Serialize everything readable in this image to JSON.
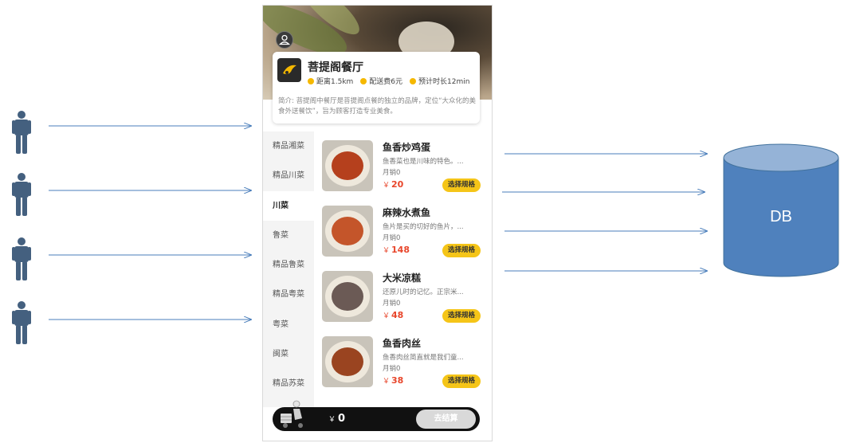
{
  "colors": {
    "arrow": "#4a7ebb",
    "person": "#44607f",
    "db_body": "#4f81bd",
    "db_top": "#95b3d7",
    "accent_yellow": "#f5c518",
    "price_red": "#e8462b"
  },
  "diagram": {
    "users": [
      {
        "icon": "person-icon"
      },
      {
        "icon": "person-icon"
      },
      {
        "icon": "person-icon"
      },
      {
        "icon": "person-icon"
      }
    ],
    "db_label": "DB"
  },
  "app": {
    "shop_name": "菩提阁餐厅",
    "meta": {
      "distance": "距离1.5km",
      "delivery_fee": "配送费6元",
      "eta": "预计时长12min"
    },
    "description": "简介: 菩提阁中餐厅是菩提阁点餐的独立的品牌，定位“大众化的美食外送餐饮”，旨为顾客打造专业美食。",
    "categories": [
      "精品湘菜",
      "精品川菜",
      "川菜",
      "鲁菜",
      "精品鲁菜",
      "精品粤菜",
      "粤菜",
      "闽菜",
      "精品苏菜"
    ],
    "active_category": "川菜",
    "dishes": [
      {
        "name": "鱼香炒鸡蛋",
        "desc": "鱼香菜也是川味的特色。...",
        "sales": "月销0",
        "currency": "￥",
        "price": "20",
        "button": "选择规格",
        "food_color": "#b5401d"
      },
      {
        "name": "麻辣水煮鱼",
        "desc": "鱼片是买的切好的鱼片，...",
        "sales": "月销0",
        "currency": "￥",
        "price": "148",
        "button": "选择规格",
        "food_color": "#c4552a"
      },
      {
        "name": "大米凉糕",
        "desc": "还原儿时的记忆。正宗米...",
        "sales": "月销0",
        "currency": "￥",
        "price": "48",
        "button": "选择规格",
        "food_color": "#6b5a55"
      },
      {
        "name": "鱼香肉丝",
        "desc": "鱼香肉丝简直就是我们童...",
        "sales": "月销0",
        "currency": "￥",
        "price": "38",
        "button": "选择规格",
        "food_color": "#9a4420"
      }
    ],
    "cart": {
      "currency": "￥",
      "total": "0",
      "checkout": "去结算"
    }
  }
}
